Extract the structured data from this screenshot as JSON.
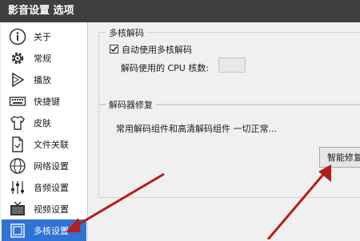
{
  "window": {
    "title": "影音设置 选项"
  },
  "sidebar": {
    "items": [
      {
        "label": "关于",
        "icon": "info-icon"
      },
      {
        "label": "常规",
        "icon": "gear-icon"
      },
      {
        "label": "播放",
        "icon": "play-icon"
      },
      {
        "label": "快捷键",
        "icon": "keyboard-icon"
      },
      {
        "label": "皮肤",
        "icon": "shirt-icon"
      },
      {
        "label": "文件关联",
        "icon": "file-icon"
      },
      {
        "label": "网络设置",
        "icon": "network-icon"
      },
      {
        "label": "音频设置",
        "icon": "audio-icon"
      },
      {
        "label": "视频设置",
        "icon": "tv-icon"
      },
      {
        "label": "多核设置",
        "icon": "multicore-icon",
        "selected": true
      }
    ]
  },
  "multicore": {
    "title": "多核解码",
    "checkbox_label": "自动使用多核解码",
    "checked": true,
    "cpu_label": "解码使用的 CPU 核数:",
    "cpu_value": ""
  },
  "repair": {
    "title": "解码器修复",
    "status": "常用解码组件和高清解码组件 一切正常...",
    "button_label": "智能修复"
  },
  "colors": {
    "selected": "#2f73d4",
    "arrow": "#b71c1c",
    "titlebar": "#3f3f3f"
  }
}
